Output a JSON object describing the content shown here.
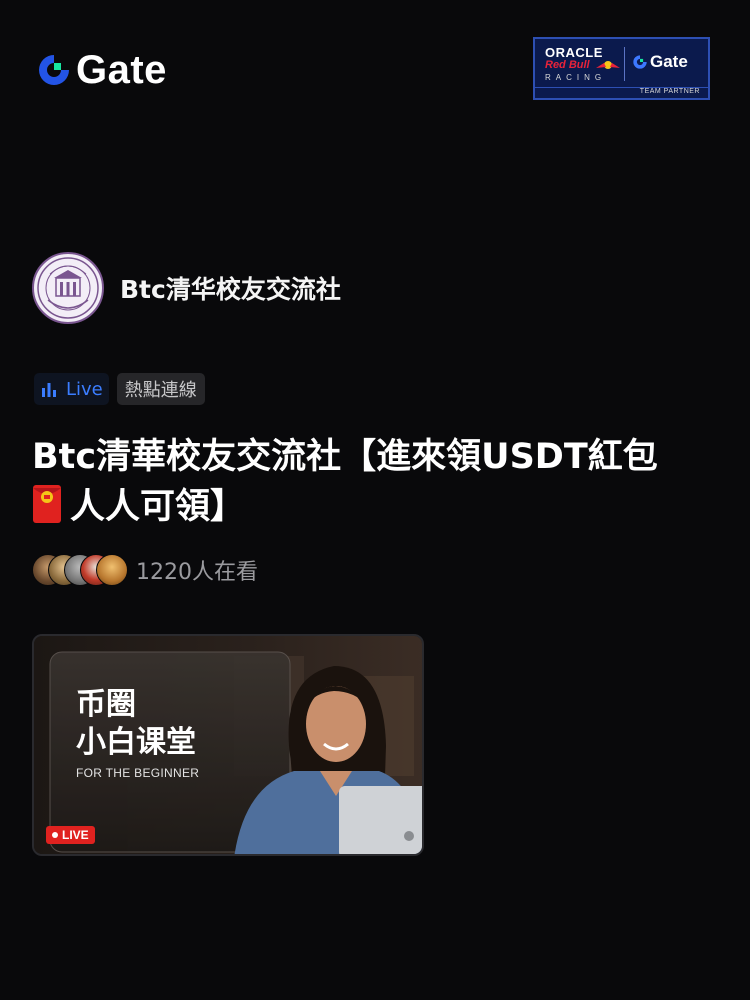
{
  "header": {
    "brand": "Gate",
    "partner_badge": {
      "oracle": "ORACLE",
      "redbull": "Red Bull",
      "racing": "RACING",
      "gate": "Gate",
      "footer": "TEAM PARTNER"
    }
  },
  "community": {
    "name": "Btc清华校友交流社",
    "avatar_icon": "university-seal-icon"
  },
  "tags": {
    "live_label": "Live",
    "hot_label": "熱點連線"
  },
  "stream": {
    "title_part1": "Btc清華校友交流社【進來領USDT紅包",
    "title_part2": "人人可領】",
    "envelope_icon": "red-envelope-icon",
    "viewers_text": "1220人在看"
  },
  "thumbnail": {
    "title": "币圈\n小白课堂",
    "subtitle": "FOR THE BEGINNER",
    "live_badge": "LIVE"
  },
  "colors": {
    "background": "#09090b",
    "accent_blue": "#3b7dff",
    "live_red": "#e0221f",
    "gate_green": "#17e6a1"
  }
}
